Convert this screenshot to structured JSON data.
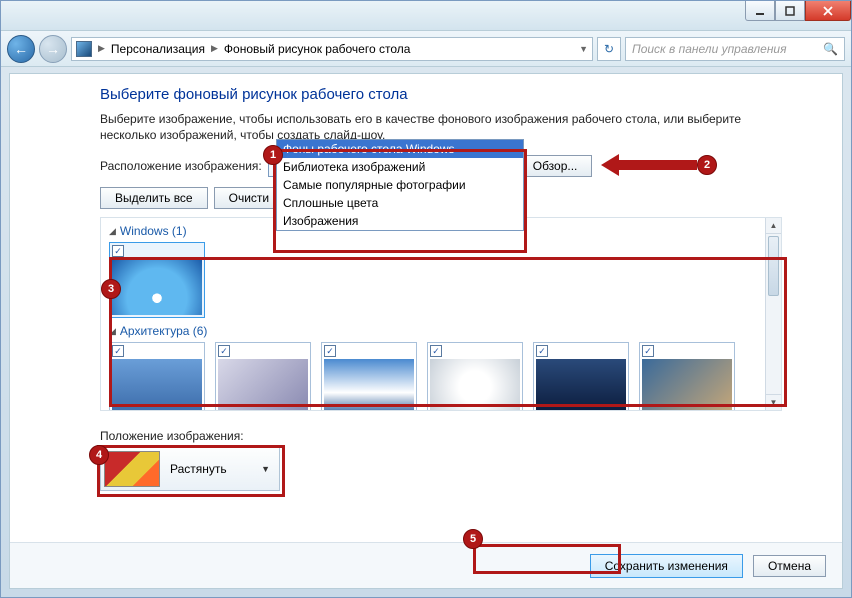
{
  "nav": {
    "breadcrumb1": "Персонализация",
    "breadcrumb2": "Фоновый рисунок рабочего стола",
    "search_placeholder": "Поиск в панели управления"
  },
  "main": {
    "title": "Выберите фоновый рисунок рабочего стола",
    "description": "Выберите изображение, чтобы использовать его в качестве фонового изображения рабочего стола, или выберите несколько изображений, чтобы создать слайд-шоу.",
    "location_label": "Расположение изображения:",
    "location_value": "Фоны рабочего стола Windows",
    "browse": "Обзор...",
    "select_all": "Выделить все",
    "clear_all": "Очисти",
    "dropdown": {
      "options": [
        "Фоны рабочего стола Windows",
        "Библиотека изображений",
        "Самые популярные фотографии",
        "Сплошные цвета",
        "Изображения"
      ]
    },
    "group1_name": "Windows (1)",
    "group2_name": "Архитектура (6)",
    "position_label": "Положение изображения:",
    "position_value": "Растянуть"
  },
  "footer": {
    "save": "Сохранить изменения",
    "cancel": "Отмена"
  },
  "annotations": [
    "1",
    "2",
    "3",
    "4",
    "5"
  ]
}
